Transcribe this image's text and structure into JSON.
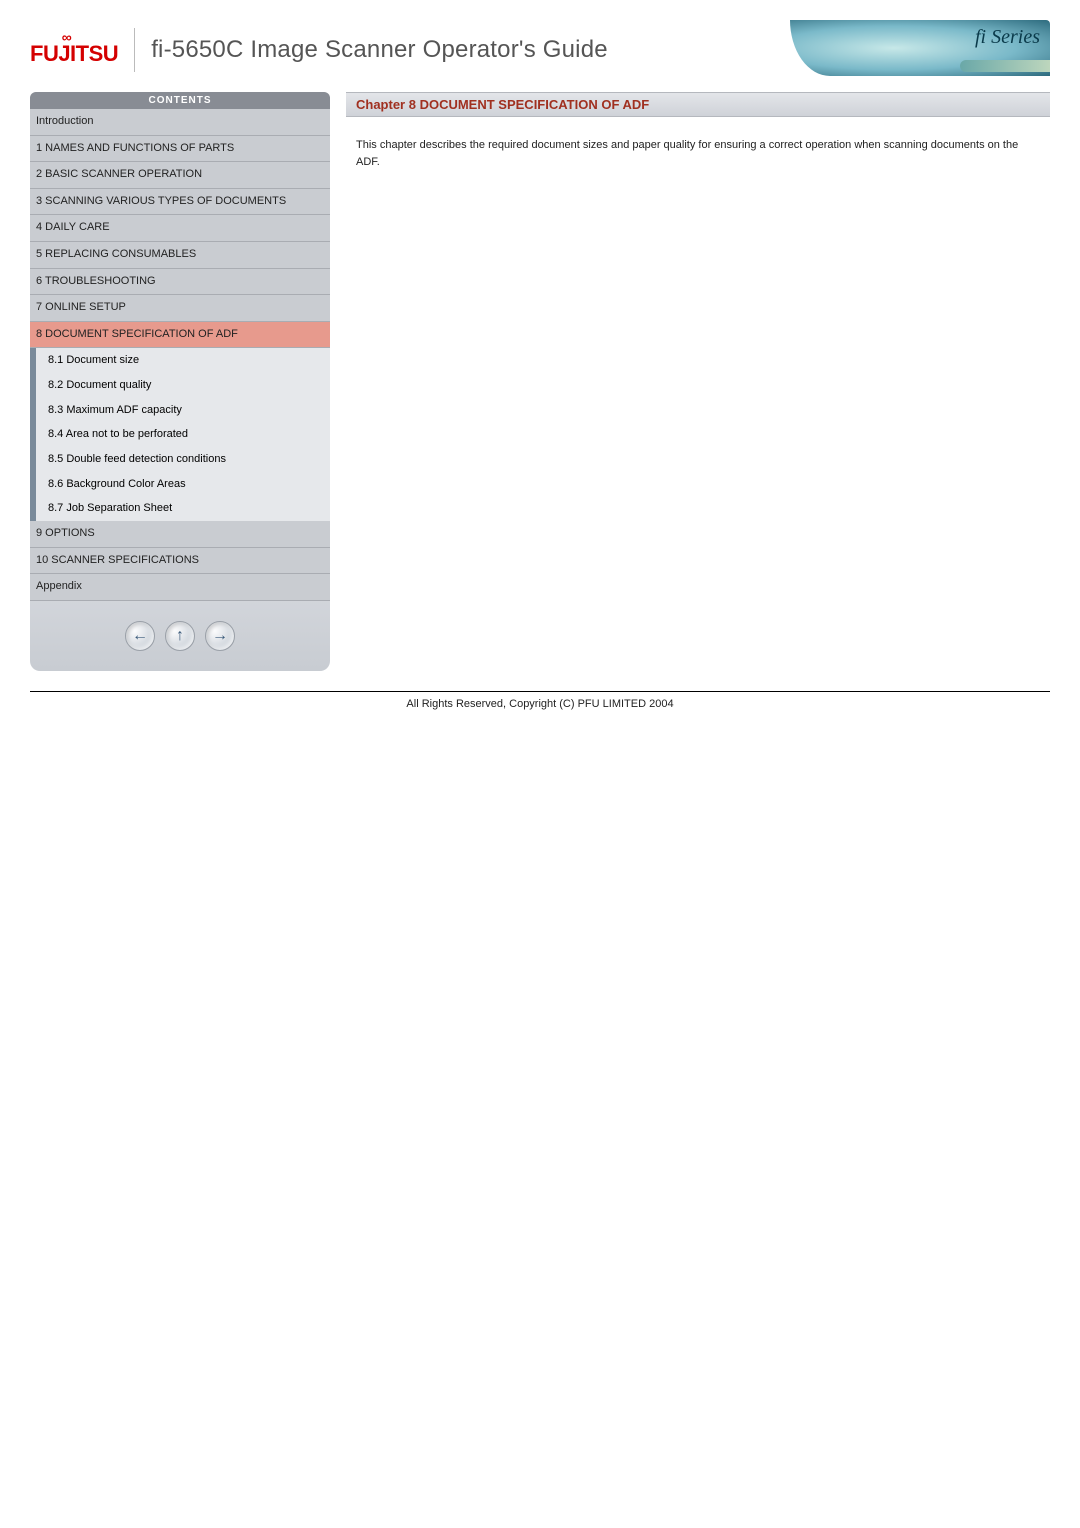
{
  "header": {
    "brand": "FUJITSU",
    "title": "fi-5650C Image Scanner Operator's Guide",
    "series_label": "fi Series"
  },
  "sidebar": {
    "header": "CONTENTS",
    "items": [
      {
        "label": "Introduction",
        "active": false
      },
      {
        "label": "1 NAMES AND FUNCTIONS OF PARTS",
        "active": false
      },
      {
        "label": "2 BASIC SCANNER OPERATION",
        "active": false
      },
      {
        "label": "3 SCANNING VARIOUS TYPES OF DOCUMENTS",
        "active": false
      },
      {
        "label": "4 DAILY CARE",
        "active": false
      },
      {
        "label": "5 REPLACING CONSUMABLES",
        "active": false
      },
      {
        "label": "6 TROUBLESHOOTING",
        "active": false
      },
      {
        "label": "7 ONLINE SETUP",
        "active": false
      },
      {
        "label": "8 DOCUMENT SPECIFICATION OF ADF",
        "active": true,
        "subs": [
          "8.1 Document size",
          "8.2 Document quality",
          "8.3 Maximum ADF capacity",
          "8.4 Area not to be perforated",
          "8.5 Double feed detection conditions",
          "8.6 Background Color Areas",
          "8.7 Job Separation Sheet"
        ]
      },
      {
        "label": "9 OPTIONS",
        "active": false
      },
      {
        "label": "10 SCANNER SPECIFICATIONS",
        "active": false
      },
      {
        "label": "Appendix",
        "active": false
      }
    ],
    "nav": {
      "prev": "←",
      "up": "↑",
      "next": "→"
    }
  },
  "main": {
    "chapter_title": "Chapter 8 DOCUMENT SPECIFICATION OF ADF",
    "body": "This chapter describes the required document sizes and paper quality for ensuring a correct operation when scanning documents on the ADF."
  },
  "footer": {
    "copyright": "All Rights Reserved, Copyright (C) PFU LIMITED 2004"
  }
}
